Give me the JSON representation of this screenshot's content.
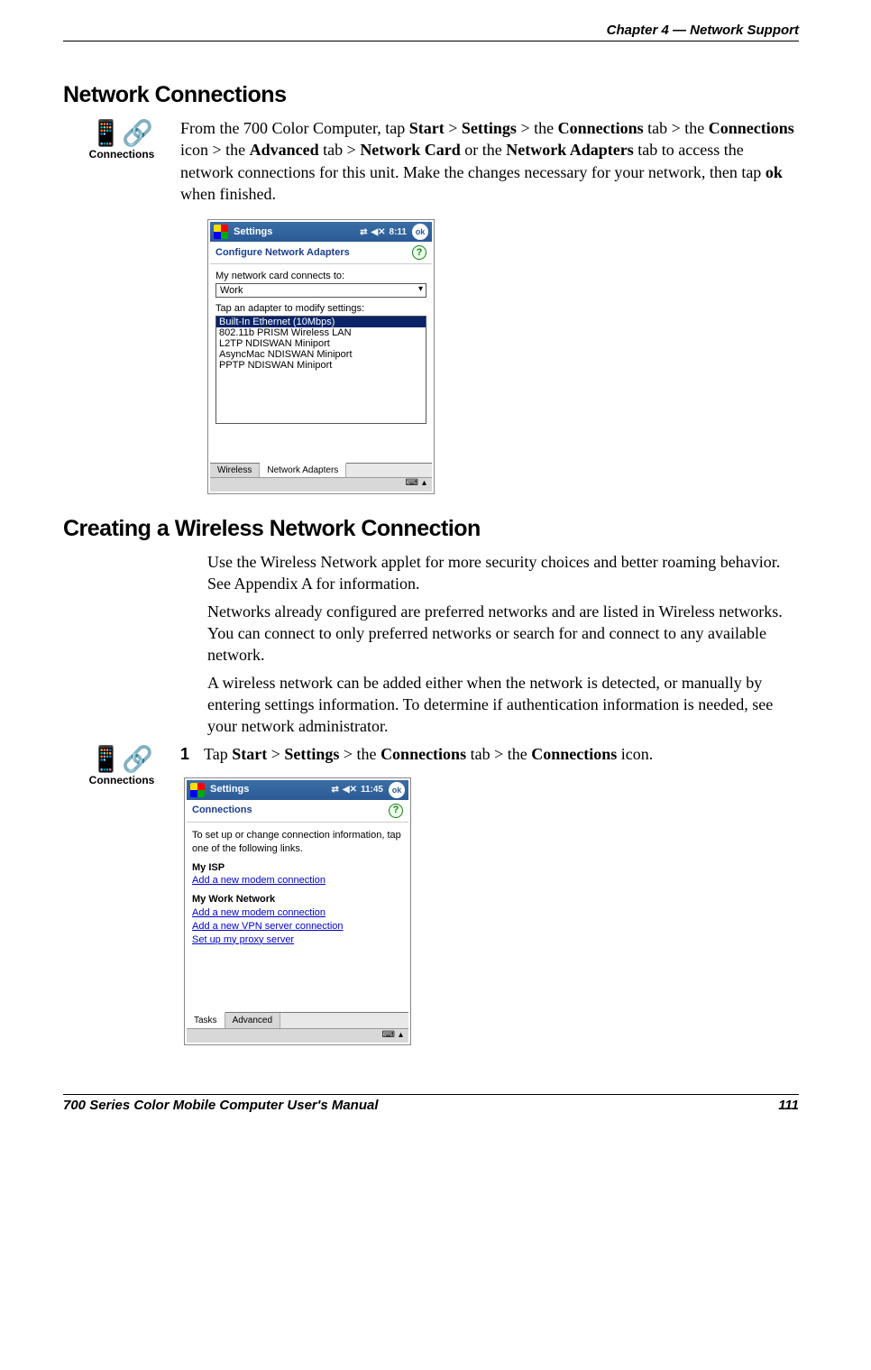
{
  "header": {
    "chapter": "Chapter  4  —  Network Support"
  },
  "section1": {
    "title": "Network Connections",
    "icon_label": "Connections",
    "para1_pre": "From the 700 Color Computer, tap ",
    "b_start": "Start",
    "gt": " > ",
    "b_settings": "Settings",
    "txt_the": " > the ",
    "b_connections_tab": "Connections",
    "txt_tab_the": " tab > the ",
    "b_connections_icon": "Connections",
    "txt_icon_the": " icon > the ",
    "b_advanced": "Advanced",
    "txt_tab": " tab > ",
    "b_netcard": "Network Card",
    "txt_or_the": " or the ",
    "b_netadapt": "Network Adapters",
    "txt_rest": " tab to access the network connections for this unit. Make the changes necessary for your network, then tap ",
    "b_ok": "ok",
    "txt_fin": " when finished."
  },
  "ppc1": {
    "title": "Settings",
    "time": "8:11",
    "ok": "ok",
    "sub": "Configure Network Adapters",
    "label1": "My network card connects to:",
    "select_value": "Work",
    "label2": "Tap an adapter to modify settings:",
    "options": [
      "Built-In Ethernet (10Mbps)",
      "802.11b PRISM Wireless LAN",
      "L2TP NDISWAN Miniport",
      "AsyncMac NDISWAN Miniport",
      "PPTP NDISWAN Miniport"
    ],
    "tabs": [
      "Wireless",
      "Network Adapters"
    ]
  },
  "section2": {
    "title": "Creating a Wireless Network Connection",
    "p1": "Use the Wireless Network applet for more security choices and better roaming behavior. See Appendix A for information.",
    "p2": "Networks already configured are preferred networks and are listed in Wireless networks. You can connect to only preferred networks or search for and connect to any available network.",
    "p3": "A wireless network can be added either when the network is detected, or manually by entering settings information. To determine if authentication information is needed, see your network administrator.",
    "icon_label": "Connections",
    "step1_num": "1",
    "step1_pre": "Tap ",
    "b_start": "Start",
    "gt": " > ",
    "b_settings": "Settings",
    "txt_the": " > the ",
    "b_conn_tab": "Connections",
    "txt_tab_the": " tab > the ",
    "b_conn_icon": "Connections",
    "txt_icon": " icon."
  },
  "ppc2": {
    "title": "Settings",
    "time": "11:45",
    "ok": "ok",
    "sub": "Connections",
    "intro": "To set up or change connection information, tap one of the following links.",
    "g1": "My ISP",
    "g1l1": "Add a new modem connection",
    "g2": "My Work Network",
    "g2l1": "Add a new modem connection",
    "g2l2": "Add a new VPN server connection",
    "g2l3": "Set up my proxy server",
    "tabs": [
      "Tasks",
      "Advanced"
    ]
  },
  "footer": {
    "left": "700 Series Color Mobile Computer User's Manual",
    "right": "111"
  }
}
